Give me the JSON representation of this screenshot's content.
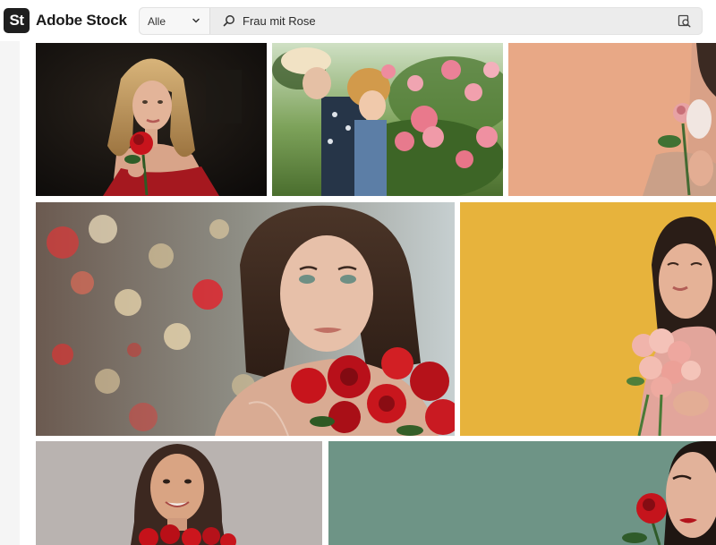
{
  "app": {
    "logo_text": "St",
    "brand_name": "Adobe Stock"
  },
  "search": {
    "filter_selected": "Alle",
    "query": "Frau mit Rose",
    "placeholder": "Frau mit Rose"
  },
  "results": [
    {
      "subject": "blonde woman in red dress holding red rose",
      "background": "dark"
    },
    {
      "subject": "woman and child smelling pink roses in garden",
      "background": "garden"
    },
    {
      "subject": "woman holding pink rose",
      "background": "peach"
    },
    {
      "subject": "brunette woman with red roses",
      "background": "bokeh lights"
    },
    {
      "subject": "smiling woman holding pink rose bouquet",
      "background": "yellow"
    },
    {
      "subject": "smiling woman holding red roses",
      "background": "grey"
    },
    {
      "subject": "woman with red lips holding red rose",
      "background": "teal"
    }
  ],
  "colors": {
    "header_bg": "#ffffff",
    "search_bg": "#ececec",
    "logo_bg": "#1f1f1f",
    "yellow_bg": "#e7b33c",
    "teal_bg": "#6e9486",
    "peach_bg": "#e9a986"
  }
}
